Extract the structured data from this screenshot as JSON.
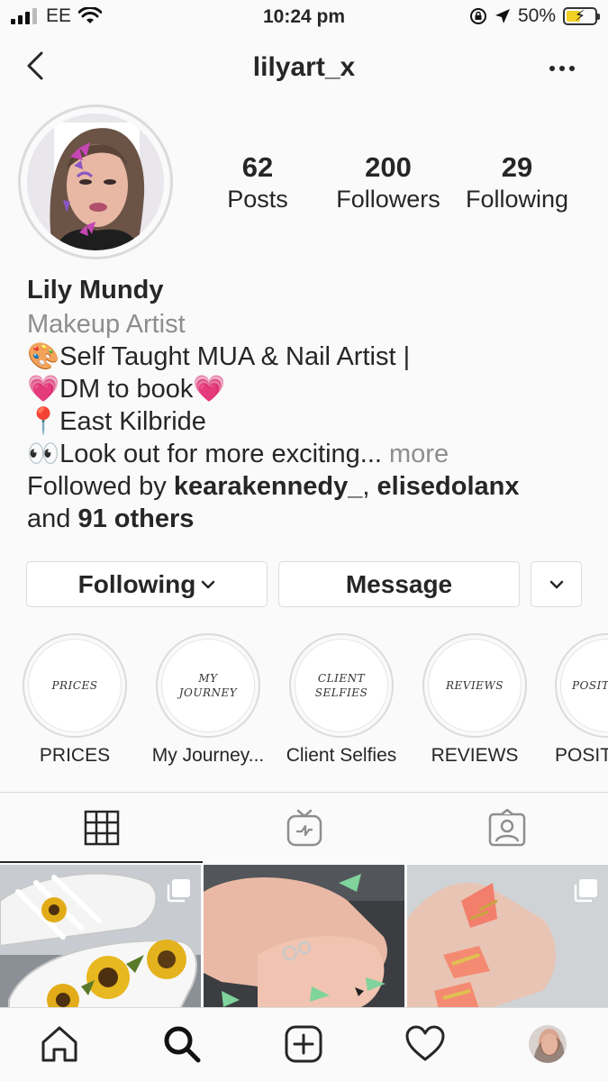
{
  "status_bar": {
    "carrier": "EE",
    "time": "10:24 pm",
    "battery_percent": "50%",
    "battery_level": 0.5,
    "icons": [
      "signal-icon",
      "wifi-icon",
      "orientation-lock-icon",
      "location-icon",
      "battery-icon"
    ]
  },
  "header": {
    "username": "lilyart_x",
    "icons": [
      "back-icon",
      "more-icon"
    ]
  },
  "stats": [
    {
      "value": "62",
      "label": "Posts"
    },
    {
      "value": "200",
      "label": "Followers"
    },
    {
      "value": "29",
      "label": "Following"
    }
  ],
  "bio": {
    "name": "Lily Mundy",
    "category": "Makeup Artist",
    "line1": "🎨Self Taught MUA & Nail Artist |",
    "line2": "💗DM to book💗",
    "line3": "📍East Kilbride",
    "line4": "👀Look out for more exciting...",
    "more": " more",
    "followed_by_prefix": "Followed by ",
    "follower1": "kearakennedy_",
    "comma": ", ",
    "follower2": "elisedolanx",
    "and_text": "and ",
    "others": "91 others"
  },
  "buttons": {
    "following": "Following",
    "message": "Message"
  },
  "highlights": [
    {
      "cover": "PRICES",
      "label": "PRICES"
    },
    {
      "cover": "MY JOURNEY",
      "label": "My Journey..."
    },
    {
      "cover": "CLIENT SELFIES",
      "label": "Client Selfies"
    },
    {
      "cover": "REVIEWS",
      "label": "REVIEWS"
    },
    {
      "cover": "POSITIVITY",
      "label": "POSIT"
    }
  ],
  "tabs": [
    "grid-icon",
    "igtv-icon",
    "tagged-icon"
  ],
  "posts": [
    {
      "subject": "sunflower-painted-sneakers",
      "multi": true
    },
    {
      "subject": "green-tipped-nails",
      "multi": false
    },
    {
      "subject": "coral-glitter-nails",
      "multi": true
    }
  ],
  "bottom_nav": [
    "home-icon",
    "search-icon",
    "new-post-icon",
    "activity-icon",
    "profile-avatar"
  ],
  "colors": {
    "background": "#fafafa",
    "text": "#262626",
    "secondary": "#8e8e8e",
    "border": "#dbdbdb",
    "battery_fill": "#f2d024"
  }
}
